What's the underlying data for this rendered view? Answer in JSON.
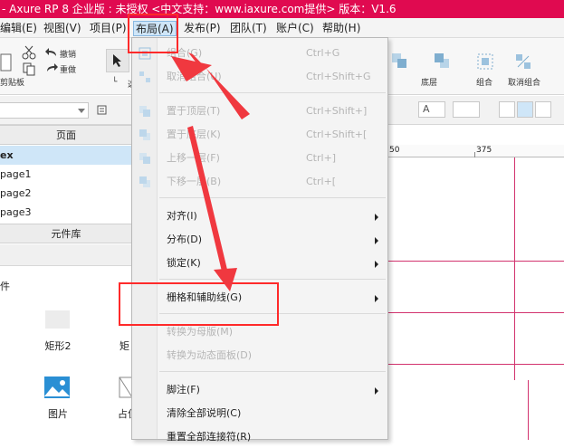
{
  "title_bar": {
    "text": "- Axure RP 8 企业版 : 未授权    <中文支持：www.iaxure.com提供> 版本：V1.6"
  },
  "menubar": {
    "items": [
      {
        "label": "编辑(E)"
      },
      {
        "label": "视图(V)"
      },
      {
        "label": "项目(P)"
      },
      {
        "label": "布局(A)"
      },
      {
        "label": "发布(P)"
      },
      {
        "label": "团队(T)"
      },
      {
        "label": "账户(C)"
      },
      {
        "label": "帮助(H)"
      }
    ]
  },
  "toolbar": {
    "undo_label": "撤销",
    "redo_label": "重做",
    "clipboard_label": "剪贴板",
    "select_label": "选",
    "bottom_label": "底层",
    "group_label": "组合",
    "ungroup_label": "取消组合"
  },
  "left_panel": {
    "pages_header": "页面",
    "pages": [
      "ex",
      "page1",
      "page2",
      "page3"
    ],
    "library_header": "元件库",
    "library_prefix": "件",
    "widgets": [
      {
        "label": "矩形2"
      },
      {
        "label": "矩"
      },
      {
        "label": "图片"
      },
      {
        "label": "占位"
      }
    ]
  },
  "ruler": {
    "ticks": [
      "50",
      "375"
    ]
  },
  "dropdown": {
    "items": [
      {
        "label": "组合(G)",
        "shortcut": "Ctrl+G",
        "disabled": true
      },
      {
        "label": "取消组合(U)",
        "shortcut": "Ctrl+Shift+G",
        "disabled": true
      },
      {
        "label": "置于顶层(T)",
        "shortcut": "Ctrl+Shift+]",
        "disabled": true
      },
      {
        "label": "置于底层(K)",
        "shortcut": "Ctrl+Shift+[",
        "disabled": true
      },
      {
        "label": "上移一层(F)",
        "shortcut": "Ctrl+]",
        "disabled": true
      },
      {
        "label": "下移一层(B)",
        "shortcut": "Ctrl+[",
        "disabled": true
      },
      {
        "label": "对齐(I)",
        "shortcut": "",
        "disabled": false,
        "submenu": true
      },
      {
        "label": "分布(D)",
        "shortcut": "",
        "disabled": false,
        "submenu": true
      },
      {
        "label": "锁定(K)",
        "shortcut": "",
        "disabled": false,
        "submenu": true
      },
      {
        "label": "栅格和辅助线(G)",
        "shortcut": "",
        "disabled": false,
        "submenu": true
      },
      {
        "label": "转换为母版(M)",
        "shortcut": "",
        "disabled": true
      },
      {
        "label": "转换为动态面板(D)",
        "shortcut": "",
        "disabled": true
      },
      {
        "label": "脚注(F)",
        "shortcut": "",
        "disabled": false,
        "submenu": true
      },
      {
        "label": "清除全部说明(C)",
        "shortcut": "",
        "disabled": false
      },
      {
        "label": "重置全部连接符(R)",
        "shortcut": "",
        "disabled": false
      }
    ]
  },
  "colors": {
    "accent": "#e00a50",
    "highlight": "#ff2a2a",
    "guide": "#d2336e",
    "selection": "#cfe6f8"
  }
}
